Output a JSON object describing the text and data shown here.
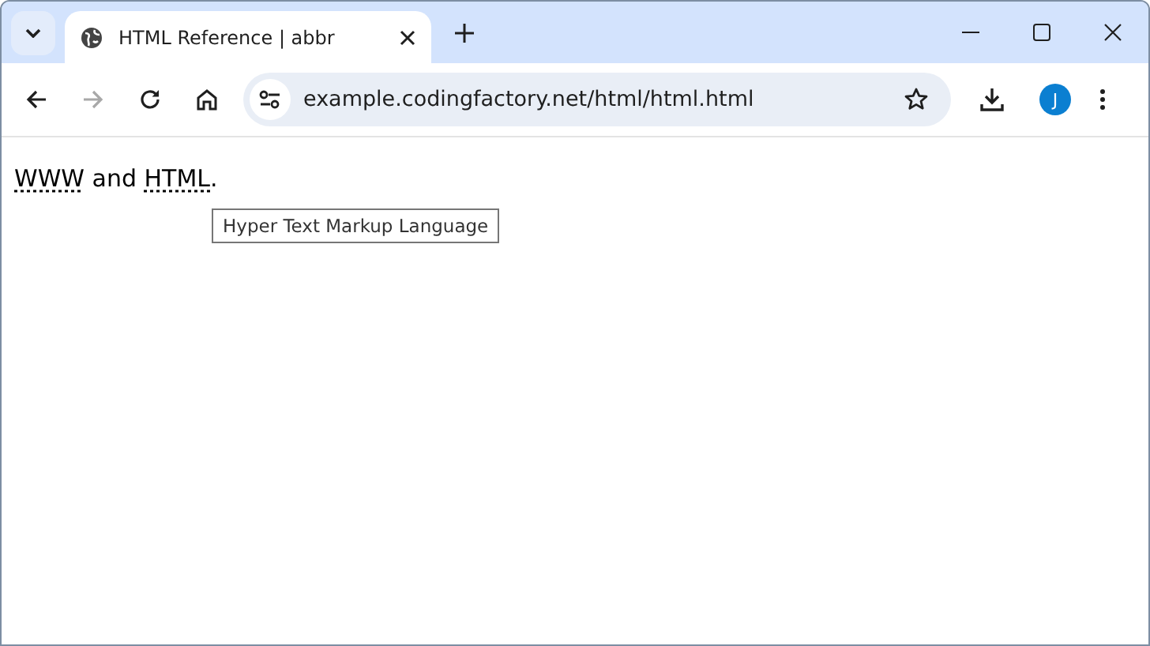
{
  "tab": {
    "title": "HTML Reference | abbr",
    "selected": true
  },
  "address_bar": {
    "url": "example.codingfactory.net/html/html.html"
  },
  "toolbar": {
    "forward_disabled": true,
    "profile_initial": "J"
  },
  "paragraph": [
    {
      "kind": "abbr",
      "text": "WWW"
    },
    {
      "kind": "plain",
      "text": " and "
    },
    {
      "kind": "abbr",
      "text": "HTML"
    },
    {
      "kind": "plain",
      "text": "."
    }
  ],
  "tooltip": {
    "text": "Hyper Text Markup Language"
  }
}
